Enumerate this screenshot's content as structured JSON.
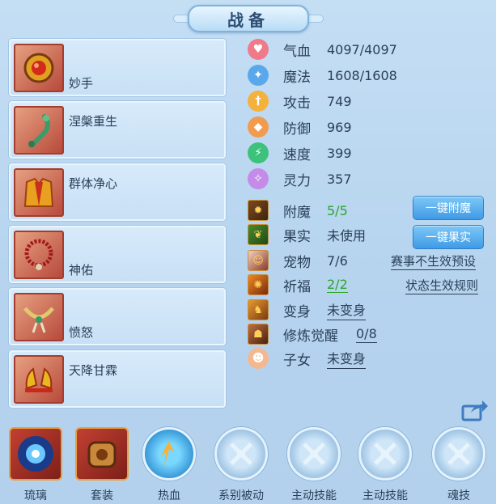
{
  "title": "战备",
  "equipment": [
    {
      "name": "妙手",
      "icon": "fire-ring-icon"
    },
    {
      "name": "涅槃重生",
      "icon": "jade-pendant-icon"
    },
    {
      "name": "群体净心",
      "icon": "robe-icon"
    },
    {
      "name": "神佑",
      "icon": "beads-icon"
    },
    {
      "name": "愤怒",
      "icon": "necklace-icon"
    },
    {
      "name": "天降甘霖",
      "icon": "shoes-icon"
    }
  ],
  "stats": [
    {
      "label": "气血",
      "value": "4097/4097",
      "color": "#f07a8a",
      "icon": "heart-icon"
    },
    {
      "label": "魔法",
      "value": "1608/1608",
      "color": "#5aa8ec",
      "icon": "magic-icon"
    },
    {
      "label": "攻击",
      "value": "749",
      "color": "#f4b23c",
      "icon": "sword-icon"
    },
    {
      "label": "防御",
      "value": "969",
      "color": "#f29a4e",
      "icon": "shield-icon"
    },
    {
      "label": "速度",
      "value": "399",
      "color": "#3cc27a",
      "icon": "lightning-icon"
    },
    {
      "label": "灵力",
      "value": "357",
      "color": "#c58be8",
      "icon": "spirit-icon"
    }
  ],
  "extras": {
    "enchant": {
      "label": "附魔",
      "value": "5/5"
    },
    "fruit": {
      "label": "果实",
      "value": "未使用"
    },
    "pet": {
      "label": "宠物",
      "value": "7/6"
    },
    "blessing": {
      "label": "祈福",
      "value": "2/2"
    },
    "transform": {
      "label": "变身",
      "value": "未变身"
    },
    "awaken": {
      "label": "修炼觉醒",
      "value": "0/8"
    },
    "child": {
      "label": "子女",
      "value": "未变身"
    }
  },
  "buttons": {
    "enchant_all": "一键附魔",
    "fruit_all": "一键果实",
    "event_preset": "赛事不生效预设",
    "status_rules": "状态生效规则"
  },
  "bottom_slots": [
    {
      "label": "琉璃",
      "style": "red"
    },
    {
      "label": "套装",
      "style": "red"
    },
    {
      "label": "热血",
      "style": "round-active"
    },
    {
      "label": "系别被动",
      "style": "round"
    },
    {
      "label": "主动技能",
      "style": "round"
    },
    {
      "label": "主动技能",
      "style": "round"
    },
    {
      "label": "魂技",
      "style": "round"
    }
  ]
}
